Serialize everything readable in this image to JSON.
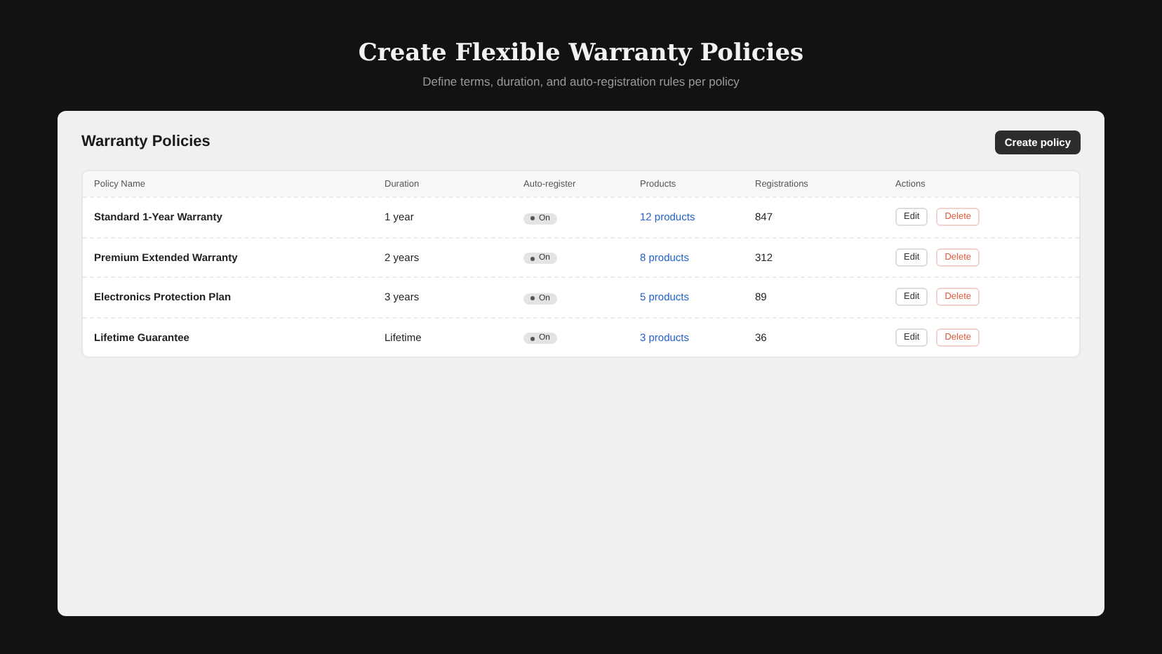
{
  "header": {
    "title": "Create Flexible Warranty Policies",
    "subtitle": "Define terms, duration, and auto-registration rules per policy"
  },
  "panel": {
    "title": "Warranty Policies",
    "create_button": "Create policy"
  },
  "table": {
    "columns": [
      "Policy Name",
      "Duration",
      "Auto-register",
      "Products",
      "Registrations",
      "Actions"
    ],
    "rows": [
      {
        "name": "Standard 1-Year Warranty",
        "duration": "1 year",
        "auto_register": {
          "on": true,
          "label": "On"
        },
        "products": "12 products",
        "registrations": "847",
        "edit": "Edit",
        "delete": "Delete"
      },
      {
        "name": "Premium Extended Warranty",
        "duration": "2 years",
        "auto_register": {
          "on": true,
          "label": "On"
        },
        "products": "8 products",
        "registrations": "312",
        "edit": "Edit",
        "delete": "Delete"
      },
      {
        "name": "Electronics Protection Plan",
        "duration": "3 years",
        "auto_register": {
          "on": true,
          "label": "On"
        },
        "products": "5 products",
        "registrations": "89",
        "edit": "Edit",
        "delete": "Delete"
      },
      {
        "name": "Lifetime Guarantee",
        "duration": "Lifetime",
        "auto_register": {
          "on": true,
          "label": "On"
        },
        "products": "3 products",
        "registrations": "36",
        "edit": "Edit",
        "delete": "Delete"
      }
    ]
  }
}
